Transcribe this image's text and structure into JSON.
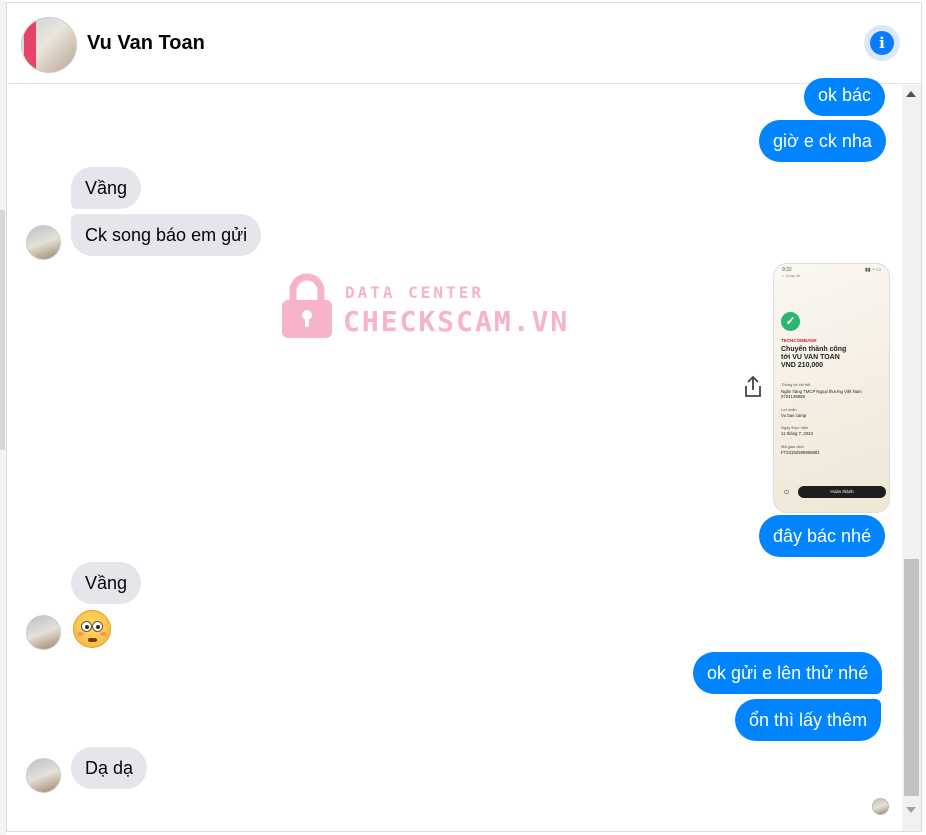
{
  "header": {
    "contact_name": "Vu Van Toan",
    "info_icon": "info-icon"
  },
  "messages": [
    {
      "side": "out",
      "text": "ok bác"
    },
    {
      "side": "out",
      "text": "giờ e ck nha"
    },
    {
      "side": "in",
      "text": "Vầng"
    },
    {
      "side": "in",
      "text": "Ck song báo em gửi"
    },
    {
      "side": "out",
      "type": "image",
      "text": "transfer-receipt-screenshot"
    },
    {
      "side": "out",
      "text": "đây bác nhé"
    },
    {
      "side": "in",
      "text": "Vầng"
    },
    {
      "side": "in",
      "type": "emoji",
      "text": "flushed-face-emoji"
    },
    {
      "side": "out",
      "text": "ok gửi e lên thử nhé"
    },
    {
      "side": "out",
      "text": "ổn thì lấy thêm"
    },
    {
      "side": "in",
      "text": "Dạ dạ"
    }
  ],
  "receipt": {
    "status_time": "9:32",
    "back_label": "< Quay lại",
    "bank": "TECHCOMBANK",
    "title_1": "Chuyển thành công",
    "title_2": "tới VU VAN TOAN",
    "amount": "VND 210,000",
    "recipient_label": "Thông tin chi tiết",
    "recipient_bank": "Ngân hàng TMCP Ngoại thương Việt Nam",
    "recipient_account": "0724135959",
    "message_label": "Lời nhắn",
    "message_value": "Vu ban camp",
    "date_label": "Ngày thực hiện",
    "date_value": "11 tháng 7, 2023",
    "txn_label": "Mã giao dịch",
    "txn_value": "FT23192599968881",
    "done_button": "Hoàn thành"
  },
  "watermark": {
    "line1": "DATA CENTER",
    "line2": "CHECKSCAM.VN"
  },
  "colors": {
    "outgoing": "#0084ff",
    "incoming": "#e4e6eb",
    "watermark": "#f7b3c8"
  }
}
